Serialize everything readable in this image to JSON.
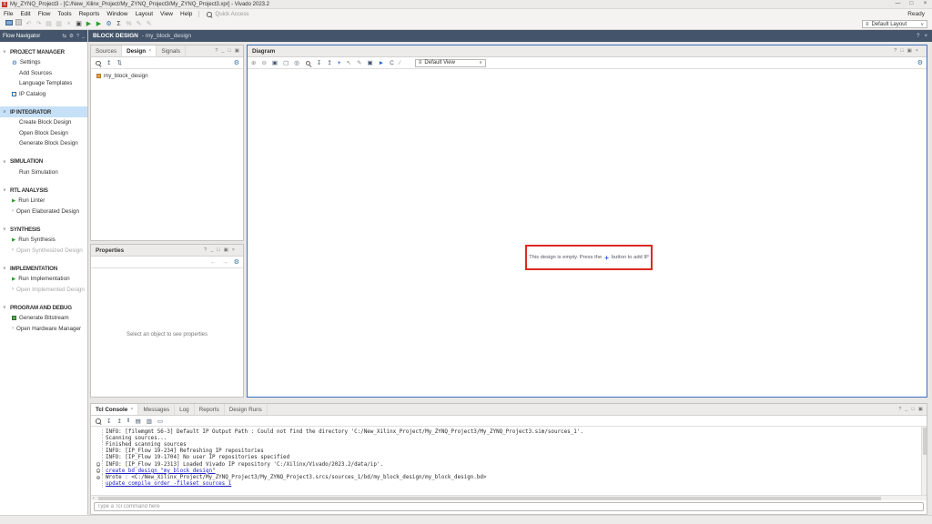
{
  "window": {
    "title": "My_ZYNQ_Project3 - [C:/New_Xilinx_Project/My_ZYNQ_Project3/My_ZYNQ_Project3.xpr] - Vivado 2023.2",
    "status": "Ready"
  },
  "menubar": {
    "items": [
      "File",
      "Edit",
      "Flow",
      "Tools",
      "Reports",
      "Window",
      "Layout",
      "View",
      "Help"
    ],
    "quick_access": "Quick Access"
  },
  "main_toolbar": {
    "layout_selector": "Default Layout"
  },
  "flow_navigator": {
    "title": "Flow Navigator",
    "sections": [
      {
        "label": "PROJECT MANAGER",
        "items": [
          {
            "label": "Settings"
          },
          {
            "label": "Add Sources"
          },
          {
            "label": "Language Templates"
          },
          {
            "label": "IP Catalog"
          }
        ]
      },
      {
        "label": "IP INTEGRATOR",
        "selected": true,
        "items": [
          {
            "label": "Create Block Design"
          },
          {
            "label": "Open Block Design"
          },
          {
            "label": "Generate Block Design"
          }
        ]
      },
      {
        "label": "SIMULATION",
        "items": [
          {
            "label": "Run Simulation"
          }
        ]
      },
      {
        "label": "RTL ANALYSIS",
        "items": [
          {
            "label": "Run Linter"
          },
          {
            "label": "Open Elaborated Design"
          }
        ]
      },
      {
        "label": "SYNTHESIS",
        "items": [
          {
            "label": "Run Synthesis"
          },
          {
            "label": "Open Synthesized Design"
          }
        ]
      },
      {
        "label": "IMPLEMENTATION",
        "items": [
          {
            "label": "Run Implementation"
          },
          {
            "label": "Open Implemented Design"
          }
        ]
      },
      {
        "label": "PROGRAM AND DEBUG",
        "items": [
          {
            "label": "Generate Bitstream"
          },
          {
            "label": "Open Hardware Manager"
          }
        ]
      }
    ]
  },
  "block_design_bar": {
    "label": "BLOCK DESIGN",
    "context": "- my_block_design"
  },
  "sources_panel": {
    "tabs": [
      "Sources",
      "Design",
      "Signals"
    ],
    "active_tab": "Design",
    "root_item": "my_block_design"
  },
  "properties_panel": {
    "title": "Properties",
    "empty_message": "Select an object to see properties"
  },
  "diagram_panel": {
    "title": "Diagram",
    "view_selector": "Default View",
    "empty_pre": "This design is empty. Press the",
    "empty_post": "button to add IP"
  },
  "tcl_console": {
    "tabs": [
      "Tcl Console",
      "Messages",
      "Log",
      "Reports",
      "Design Runs"
    ],
    "active_tab": "Tcl Console",
    "lines": [
      "INFO: [filemgmt 56-3] Default IP Output Path : Could not find the directory 'C:/New_Xilinx_Project/My_ZYNQ_Project3/My_ZYNQ_Project3.sim/sources_1'.",
      "Scanning sources...",
      "Finished scanning sources",
      "INFO: [IP_Flow 19-234] Refreshing IP repositories",
      "INFO: [IP_Flow 19-1704] No user IP repositories specified",
      "INFO: [IP_Flow 19-2313] Loaded Vivado IP repository 'C:/Xilinx/Vivado/2023.2/data/ip'.",
      "create_bd_design \"my_block_design\"",
      "Wrote : <C:/New_Xilinx_Project/My_ZYNQ_Project3/My_ZYNQ_Project3.srcs/sources_1/bd/my_block_design/my_block_design.bd>",
      "update_compile_order -fileset sources_1"
    ],
    "input_placeholder": "Type a Tcl command here"
  },
  "colors": {
    "header_bar": "#44546a",
    "selection_blue": "#c6e0f7",
    "focus_border_blue": "#3f6ec0",
    "highlight_red": "#dd2a20",
    "command_blue": "#1f1fc8",
    "run_green": "#2e9b2e",
    "accent_gear_blue": "#2d6da3"
  },
  "icons": {
    "app_logo": "X",
    "minimize": "—",
    "maximize": "□",
    "restore": "▣",
    "close": "×",
    "help": "?",
    "chevron_down": "∨",
    "chevron_right": "›",
    "caret": "∨",
    "gear": "⚙",
    "play": "▶",
    "step": "▶",
    "plus": "+",
    "hamburger": "≡",
    "back": "←",
    "forward": "→",
    "undo": "↶",
    "redo": "↷",
    "cut": "×",
    "copy": "▤",
    "paste": "▥",
    "validate": "▣",
    "sigma": "Σ",
    "percent": "%",
    "pencil": "✎",
    "zoom_in": "⊕",
    "zoom_out": "⊖",
    "zoom_fit": "▣",
    "zoom_selection": "▢",
    "autofit": "◎",
    "collapse_all": "↧",
    "expand_all": "↥",
    "pointer": "↖",
    "regenerate": "C",
    "route": "∕",
    "arrow_right": "►",
    "pause": "‖",
    "clear": "▭",
    "swap": "⇆",
    "sort": "⇅",
    "dash": "_"
  }
}
